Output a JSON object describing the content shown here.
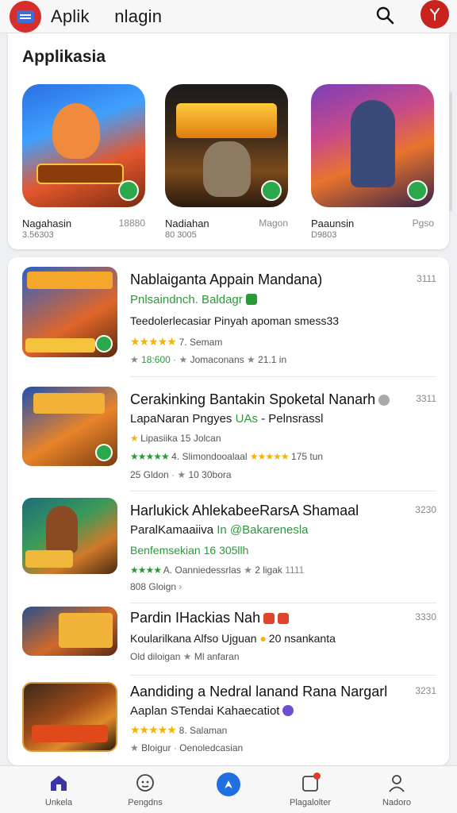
{
  "header": {
    "title": "Aplik     nlagin",
    "search_icon": "search-icon",
    "avatar_icon": "user-avatar-icon",
    "accent": "#d82d2d"
  },
  "featured": {
    "title": "Applikasia",
    "items": [
      {
        "name": "Nagahasin",
        "number": "18880",
        "sub": "3.56303",
        "badge_icon": "download-badge-icon"
      },
      {
        "name": "Nadiahan",
        "number": "Magon",
        "sub": "80 3005",
        "badge_icon": "download-badge-icon"
      },
      {
        "name": "Paaunsin",
        "number": "Pgso",
        "sub": "D9803",
        "badge_icon": "download-badge-icon"
      }
    ]
  },
  "apps": [
    {
      "title": "Nablaiganta Appain Mandana)",
      "price": "3111",
      "line1": "Pnlsaindnch. Baldagr",
      "line2": "Teedolerlecasiar Pinyah apoman smess33",
      "rating_text": "7. Semam",
      "meta_a": "18:600",
      "meta_b": "Jomaconans",
      "meta_c": "21.1 in"
    },
    {
      "title": "Cerakinking Bantakin Spoketal Nanarh",
      "price": "3311",
      "line1": "LapaNaran Pngyes",
      "line1_tag": "UAs",
      "line1_rest": "- Pelnsrassl",
      "rating_text": "Lipasiika 15 Jolcan",
      "line3_a": "4. Slimondooalaal",
      "line3_b": "175 tun",
      "meta_a": "25 Gldon",
      "meta_b": "10 30bora"
    },
    {
      "title": "Harlukick AhlekabeeRarsA Shamaal",
      "price": "3230",
      "line1": "ParalKamaaiiva",
      "line1_tag": "In @Bakarenesla",
      "line2": "Benfemsekian 16 305llh",
      "line3_a": "A. Oanniedessrlas",
      "line3_b": "2 ligak",
      "line3_c": "1111",
      "meta_a": "808 Gloign"
    },
    {
      "title": "Pardin IHackias Nah",
      "price": "3330",
      "line1": "Koularilkana Alfso Ujguan",
      "line1_b": "20 nsankanta",
      "meta_a": "Old diloigan",
      "meta_b": "Ml anfaran"
    },
    {
      "title": "Aandiding a Nedral lanand Rana Nargarl",
      "price": "3231",
      "line1": "Aaplan STendai Kahaecatiot",
      "rating_text": "8. Salaman",
      "meta_a": "Bloigur",
      "meta_b": "Oenoledcasian"
    }
  ],
  "nav": [
    {
      "label": "Unkela",
      "icon": "home-icon"
    },
    {
      "label": "Pengdns",
      "icon": "gamepad-icon"
    },
    {
      "label": "",
      "icon": "explore-icon"
    },
    {
      "label": "Plagalolter",
      "icon": "notification-icon"
    },
    {
      "label": "Nadoro",
      "icon": "profile-icon"
    }
  ],
  "colors": {
    "green": "#2a9a38",
    "star": "#f4b400",
    "nav_active": "#3a35a8",
    "fab": "#1f6fe0"
  }
}
